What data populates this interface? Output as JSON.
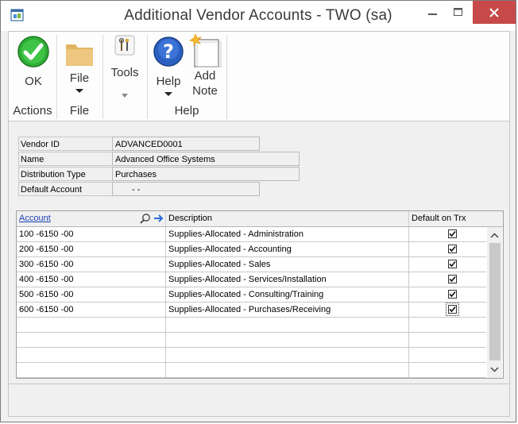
{
  "window": {
    "title": "Additional Vendor Accounts  -  TWO (sa)",
    "close_color": "#c74949"
  },
  "ribbon": {
    "ok_label": "OK",
    "file_label": "File",
    "tools_label": "Tools",
    "help_label": "Help",
    "add_note_label_1": "Add",
    "add_note_label_2": "Note",
    "groups": {
      "actions": "Actions",
      "file": "File",
      "help": "Help"
    },
    "icons": [
      "ok-check-icon",
      "folder-icon",
      "tools-icon",
      "help-question-icon",
      "note-icon"
    ]
  },
  "fields": {
    "vendor_id_label": "Vendor ID",
    "vendor_id_value": "ADVANCED0001",
    "name_label": "Name",
    "name_value": "Advanced Office Systems",
    "distribution_type_label": "Distribution Type",
    "distribution_type_value": "Purchases",
    "default_account_label": "Default Account",
    "default_account_value": "-      -"
  },
  "grid": {
    "columns": {
      "account": "Account",
      "description": "Description",
      "default_on_trx": "Default on Trx"
    },
    "rows": [
      {
        "account": "100 -6150 -00",
        "description": "Supplies-Allocated - Administration",
        "checked": true
      },
      {
        "account": "200 -6150 -00",
        "description": "Supplies-Allocated - Accounting",
        "checked": true
      },
      {
        "account": "300 -6150 -00",
        "description": "Supplies-Allocated - Sales",
        "checked": true
      },
      {
        "account": "400 -6150 -00",
        "description": "Supplies-Allocated - Services/Installation",
        "checked": true
      },
      {
        "account": "500 -6150 -00",
        "description": "Supplies-Allocated - Consulting/Training",
        "checked": true
      },
      {
        "account": "600 -6150 -00",
        "description": "Supplies-Allocated - Purchases/Receiving",
        "checked": true
      }
    ]
  },
  "colors": {
    "ok_green": "#2fae35",
    "help_blue": "#2b5fc0",
    "folder": "#e2b461",
    "link_blue": "#1a3fb5"
  }
}
